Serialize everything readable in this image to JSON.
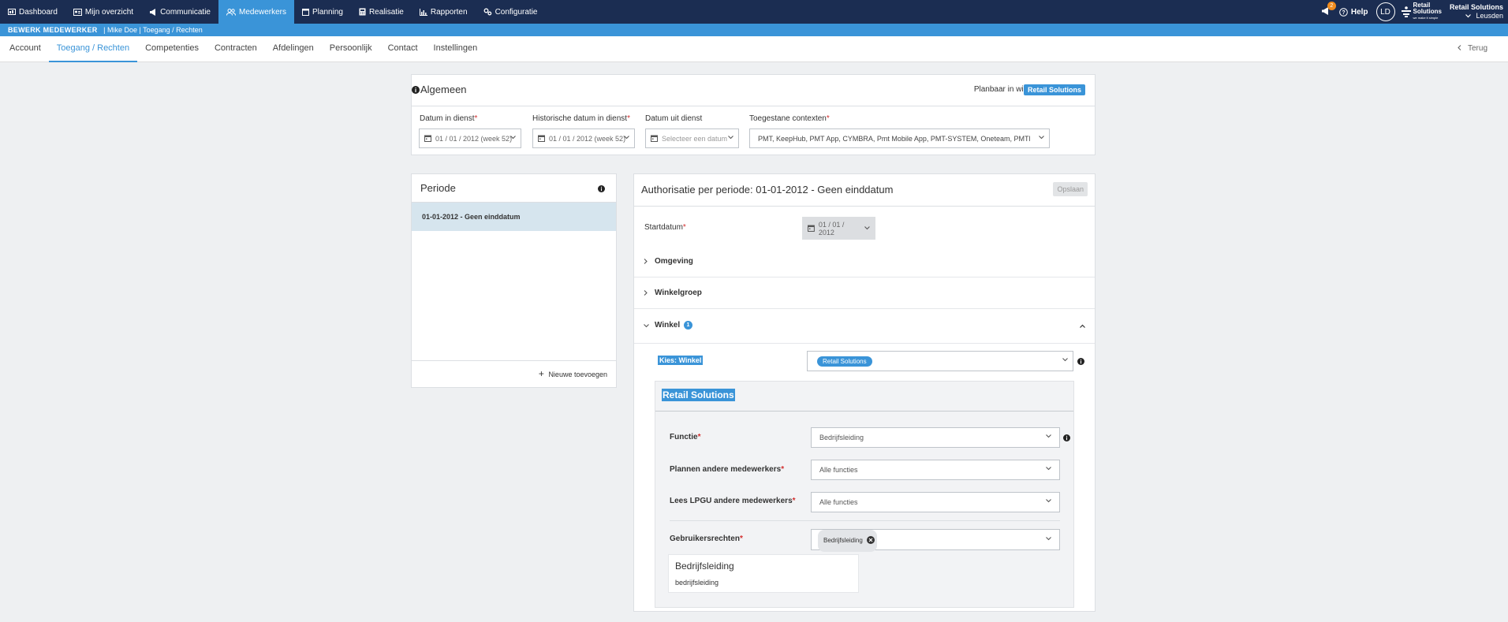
{
  "topnav": {
    "items": [
      {
        "label": "Dashboard",
        "icon": "dashboard-icon"
      },
      {
        "label": "Mijn overzicht",
        "icon": "overview-icon"
      },
      {
        "label": "Communicatie",
        "icon": "megaphone-icon"
      },
      {
        "label": "Medewerkers",
        "icon": "users-icon",
        "active": true
      },
      {
        "label": "Planning",
        "icon": "calendar-icon"
      },
      {
        "label": "Realisatie",
        "icon": "calculator-icon"
      },
      {
        "label": "Rapporten",
        "icon": "chart-icon"
      },
      {
        "label": "Configuratie",
        "icon": "gears-icon"
      }
    ],
    "notification_count": "2",
    "help_label": "Help",
    "avatar_initials": "LD",
    "logo_line1": "Retail",
    "logo_line2": "Solutions",
    "logo_tagline": "we make it simple",
    "company_name": "Retail Solutions",
    "company_location": "Leusden"
  },
  "breadcrumb": {
    "title": "BEWERK MEDEWERKER",
    "path": "| Mike Doe | Toegang / Rechten"
  },
  "tabs": {
    "items": [
      "Account",
      "Toegang / Rechten",
      "Competenties",
      "Contracten",
      "Afdelingen",
      "Persoonlijk",
      "Contact",
      "Instellingen"
    ],
    "active_index": 1,
    "back_label": "Terug"
  },
  "algemeen": {
    "title": "Algemeen",
    "planbaar_label": "Planbaar in winkel",
    "planbaar_badge": "Retail Solutions",
    "fields": {
      "datum_in_dienst": {
        "label": "Datum in dienst",
        "value": "01 / 01 / 2012 (week 52)"
      },
      "historische_datum": {
        "label": "Historische datum in dienst",
        "value": "01 / 01 / 2012 (week 52)"
      },
      "datum_uit_dienst": {
        "label": "Datum uit dienst",
        "placeholder": "Selecteer een datum"
      },
      "contexten": {
        "label": "Toegestane contexten",
        "value": "PMT, KeepHub, PMT App, CYMBRA, Pmt Mobile App, PMT-SYSTEM, Oneteam, PMTBI, Keep"
      }
    }
  },
  "periode": {
    "title": "Periode",
    "items": [
      "01-01-2012 - Geen einddatum"
    ],
    "add_label": "Nieuwe toevoegen"
  },
  "auth": {
    "title": "Authorisatie per periode: 01-01-2012 - Geen einddatum",
    "save_label": "Opslaan",
    "startdatum_label": "Startdatum",
    "startdatum_value": "01 / 01 / 2012",
    "sections": {
      "omgeving": "Omgeving",
      "winkelgroep": "Winkelgroep",
      "winkel": "Winkel",
      "winkel_count": "1"
    },
    "kies_winkel_label": "Kies: Winkel",
    "kies_winkel_chip": "Retail Solutions",
    "store": {
      "title": "Retail Solutions",
      "functie_label": "Functie",
      "functie_value": "Bedrijfsleiding",
      "plannen_label": "Plannen andere medewerkers",
      "plannen_value": "Alle functies",
      "lees_label": "Lees LPGU andere medewerkers",
      "lees_value": "Alle functies",
      "rechten_label": "Gebruikersrechten",
      "rechten_chip": "Bedrijfsleiding",
      "tooltip_title": "Bedrijfsleiding",
      "tooltip_sub": "bedrijfsleiding"
    }
  },
  "colors": {
    "nav_bg": "#1b2d52",
    "accent": "#3a94d8",
    "badge": "#f08c1e",
    "required": "#d32f2f"
  }
}
